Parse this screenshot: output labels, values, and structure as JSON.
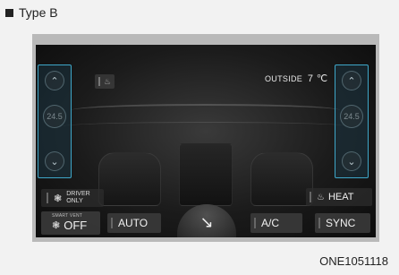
{
  "header": {
    "title": "Type B"
  },
  "panel": {
    "outside": {
      "label": "OUTSIDE",
      "temp": "7 ℃"
    },
    "left_temp": "24.5",
    "right_temp": "24.5",
    "icons": {
      "up": "chevron-up-icon",
      "down": "chevron-down-icon",
      "fan": "fan-icon",
      "seat_heat": "seat-heat-icon",
      "vent_mode": "vent-mode-icon"
    },
    "buttons": {
      "driver_only_1": "DRIVER",
      "driver_only_2": "ONLY",
      "heat": "HEAT",
      "smart_vent": "SMART VENT",
      "off": "OFF",
      "auto": "AUTO",
      "ac": "A/C",
      "sync": "SYNC"
    },
    "accent_color": "#3ea7c9"
  },
  "footer": {
    "code": "ONE1051118"
  }
}
